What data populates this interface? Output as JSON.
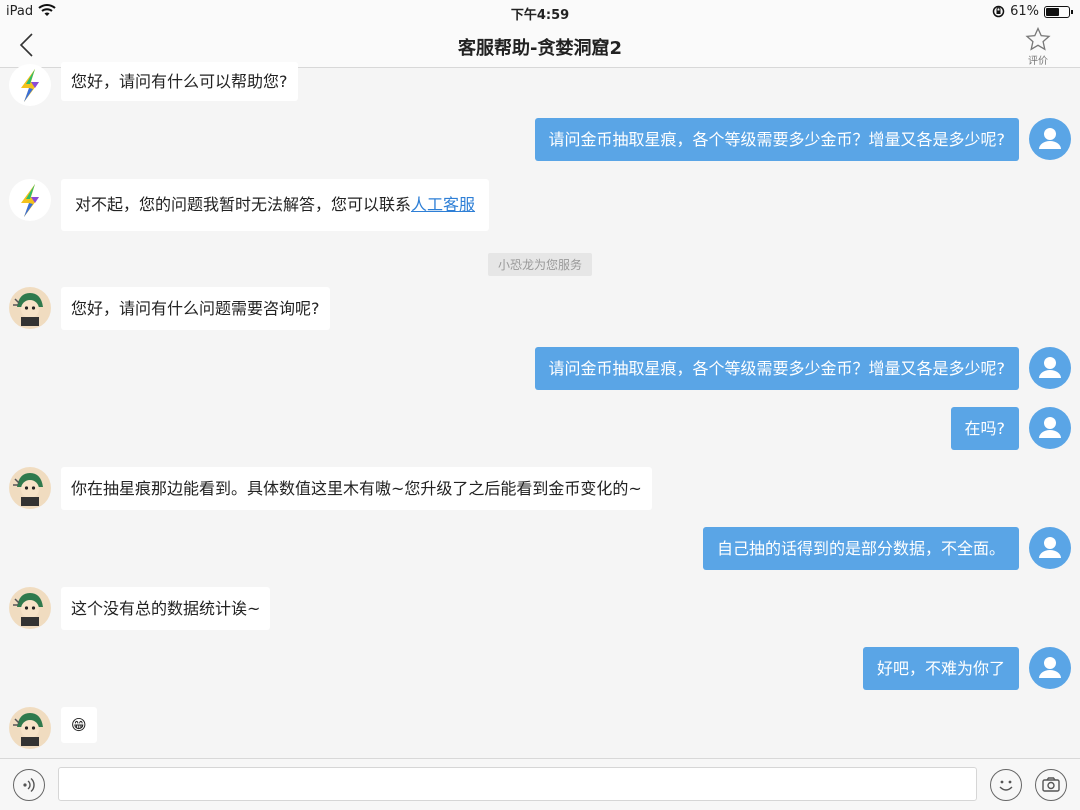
{
  "status_bar": {
    "device": "iPad",
    "time": "下午4:59",
    "battery": "61%",
    "battery_level": 0.61
  },
  "nav": {
    "title": "客服帮助-贪婪洞窟2",
    "rate_label": "评价"
  },
  "messages": [
    {
      "side": "left",
      "avatar": "bot-lightning",
      "text": "您好，请问有什么可以帮助您?"
    },
    {
      "side": "right",
      "text": "请问金币抽取星痕，各个等级需要多少金币？增量又各是多少呢?"
    },
    {
      "side": "left",
      "avatar": "bot-lightning",
      "text": "对不起，您的问题我暂时无法解答，您可以联系",
      "link": "人工客服"
    },
    {
      "side": "left",
      "avatar": "agent-dino",
      "text": "您好，请问有什么问题需要咨询呢?"
    },
    {
      "side": "right",
      "text": "请问金币抽取星痕，各个等级需要多少金币？增量又各是多少呢?"
    },
    {
      "side": "right",
      "text": "在吗?"
    },
    {
      "side": "left",
      "avatar": "agent-dino",
      "text": "你在抽星痕那边能看到。具体数值这里木有嗷~您升级了之后能看到金币变化的~"
    },
    {
      "side": "right",
      "text": "自己抽的话得到的是部分数据，不全面。"
    },
    {
      "side": "left",
      "avatar": "agent-dino",
      "text": "这个没有总的数据统计诶~"
    },
    {
      "side": "right",
      "text": "好吧，不难为你了"
    },
    {
      "side": "left",
      "avatar": "agent-dino",
      "text": "😁"
    }
  ],
  "system_notice": "小恐龙为您服务",
  "input": {
    "placeholder": "",
    "value": ""
  },
  "colors": {
    "user_bubble": "#5aa5e6",
    "link": "#2e7fd6"
  }
}
